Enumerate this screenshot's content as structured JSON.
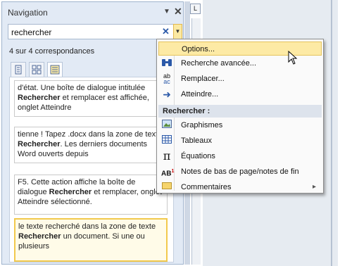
{
  "nav": {
    "title": "Navigation",
    "dropdown_icon": "triangle-down-icon",
    "close_label": "✕"
  },
  "search": {
    "value": "rechercher",
    "clear_label": "✕"
  },
  "match_count": "4 sur 4 correspondances",
  "tabs": [
    {
      "name": "headings-tab",
      "icon": "list-icon"
    },
    {
      "name": "pages-tab",
      "icon": "grid-icon"
    },
    {
      "name": "results-tab",
      "icon": "document-lines-icon",
      "active": true
    }
  ],
  "results": [
    {
      "pre": "d'état. Une boîte de dialogue intitulée ",
      "hit": "Rechercher",
      "post": " et remplacer est affichée, onglet Atteindre"
    },
    {
      "pre": "tienne ! Tapez .docx dans la zone de texte ",
      "hit": "Rechercher",
      "post": ". Les derniers documents Word ouverts depuis"
    },
    {
      "pre": "F5. Cette action affiche la boîte de dialogue ",
      "hit": "Rechercher",
      "post": " et remplacer, onglet Atteindre sélectionné."
    },
    {
      "pre": "le texte recherché dans la zone de texte ",
      "hit": "Rechercher",
      "post": " un document. Si une ou plusieurs"
    }
  ],
  "menu": {
    "items": [
      {
        "label": "Options...",
        "icon": "",
        "hover": true
      },
      {
        "label": "Recherche avancée...",
        "icon": "binoculars-icon"
      },
      {
        "label": "Remplacer...",
        "icon": "replace-icon"
      },
      {
        "label": "Atteindre...",
        "icon": "arrow-right-icon"
      }
    ],
    "section_label": "Rechercher :",
    "find_items": [
      {
        "label": "Graphismes",
        "icon": "picture-icon"
      },
      {
        "label": "Tableaux",
        "icon": "table-icon"
      },
      {
        "label": "Équations",
        "icon": "pi-icon"
      },
      {
        "label": "Notes de bas de page/notes de fin",
        "icon": "footnote-icon"
      },
      {
        "label": "Commentaires",
        "icon": "comment-icon",
        "submenu": true
      }
    ]
  },
  "ruler_label": "L"
}
